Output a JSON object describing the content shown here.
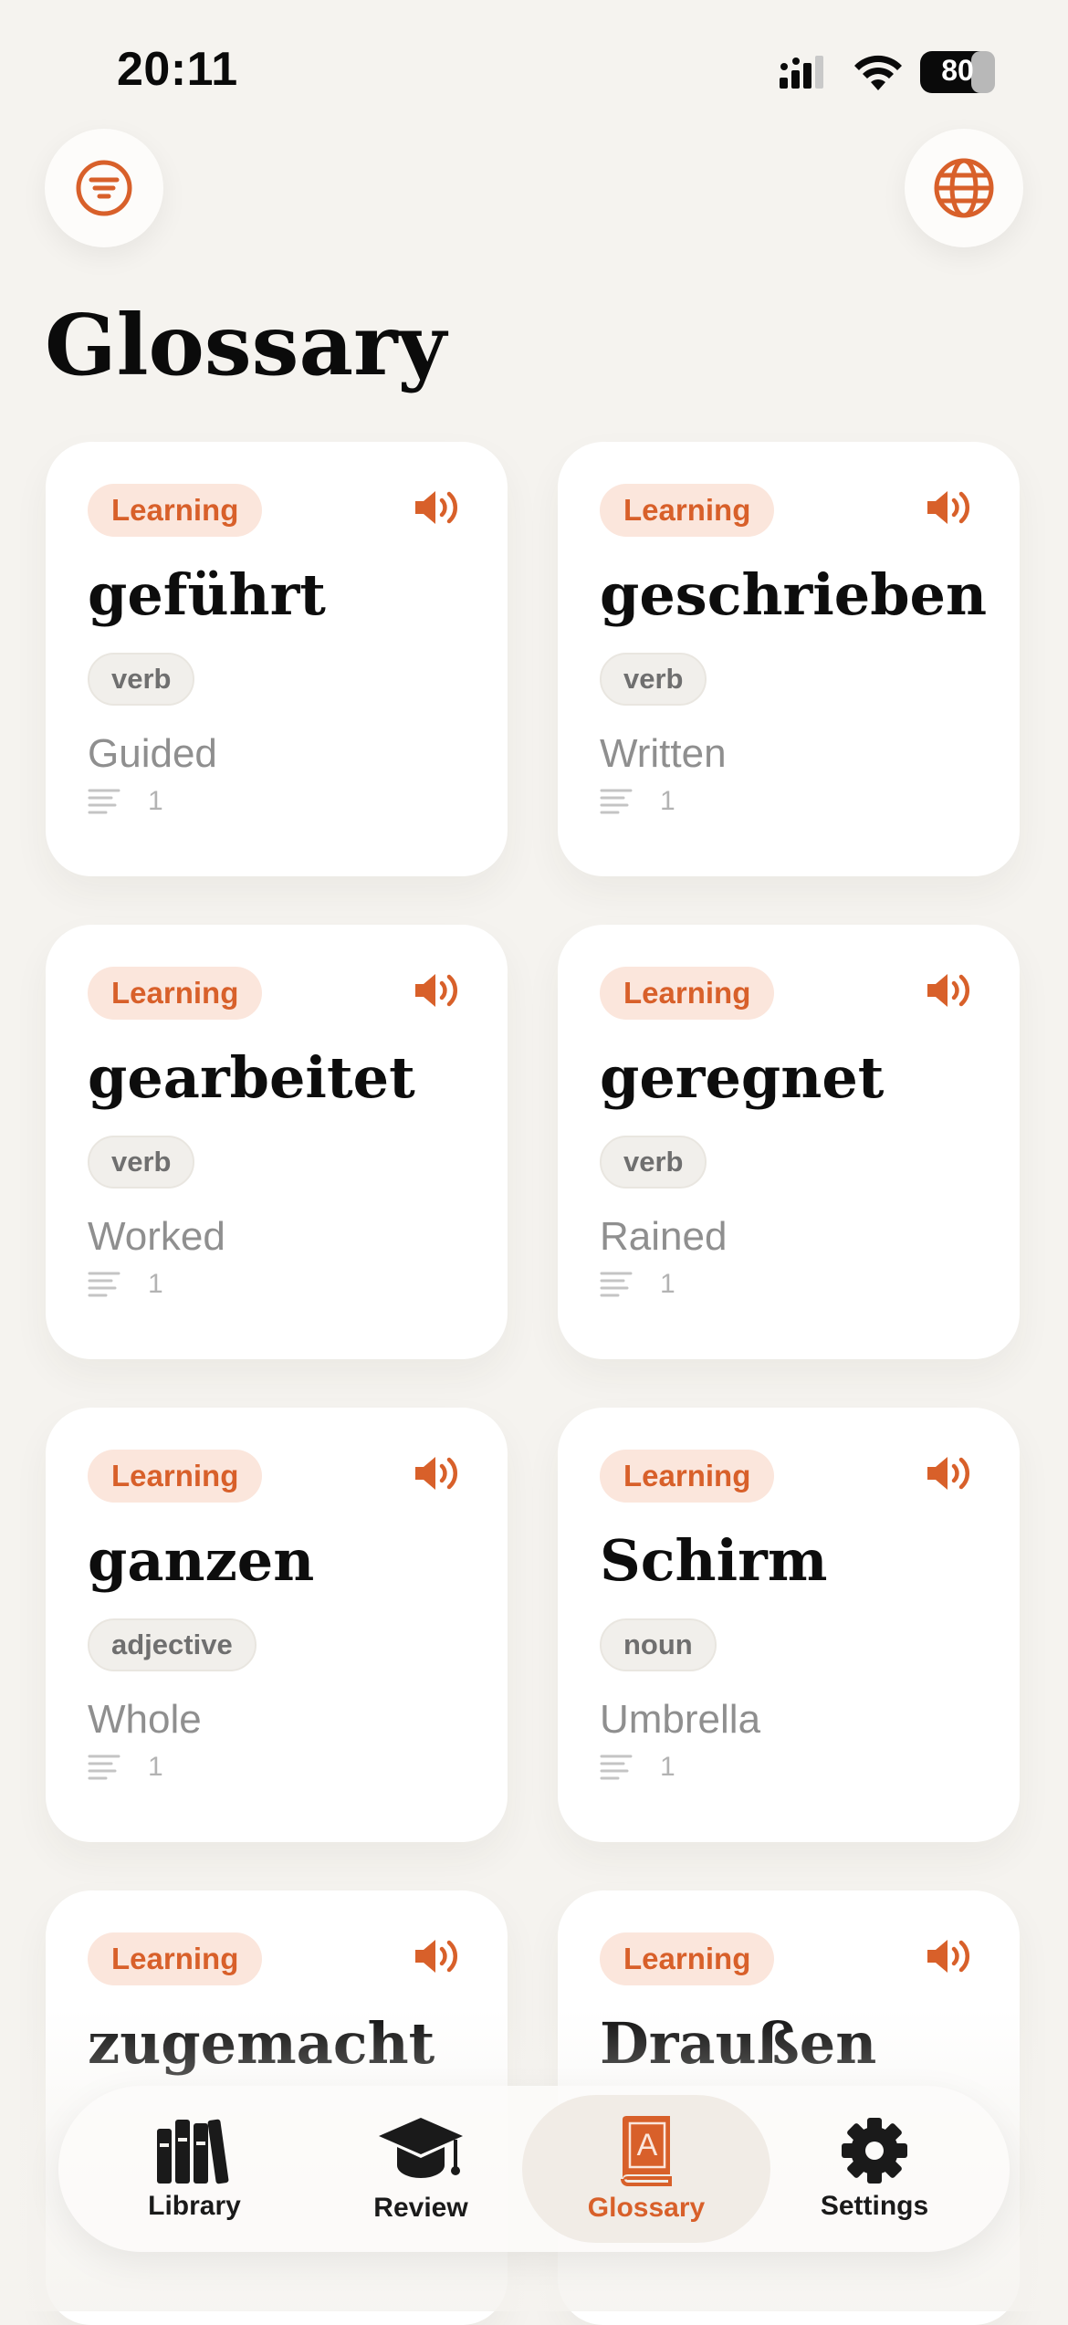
{
  "status_bar": {
    "time": "20:11",
    "battery": "80"
  },
  "header": {
    "title": "Glossary",
    "filter_icon": "filter-icon",
    "language_icon": "globe-icon"
  },
  "colors": {
    "accent": "#d8602a",
    "background": "#f5f3ef",
    "card": "#ffffff",
    "status_pill_bg": "#fbe6dc"
  },
  "cards": [
    {
      "status": "Learning",
      "word": "geführt",
      "pos": "verb",
      "meaning": "Guided",
      "refs": "1"
    },
    {
      "status": "Learning",
      "word": "geschrieben",
      "pos": "verb",
      "meaning": "Written",
      "refs": "1"
    },
    {
      "status": "Learning",
      "word": "gearbeitet",
      "pos": "verb",
      "meaning": "Worked",
      "refs": "1"
    },
    {
      "status": "Learning",
      "word": "geregnet",
      "pos": "verb",
      "meaning": "Rained",
      "refs": "1"
    },
    {
      "status": "Learning",
      "word": "ganzen",
      "pos": "adjective",
      "meaning": "Whole",
      "refs": "1"
    },
    {
      "status": "Learning",
      "word": "Schirm",
      "pos": "noun",
      "meaning": "Umbrella",
      "refs": "1"
    },
    {
      "status": "Learning",
      "word": "zugemacht",
      "pos": "",
      "meaning": "",
      "refs": ""
    },
    {
      "status": "Learning",
      "word": "Draußen",
      "pos": "",
      "meaning": "",
      "refs": ""
    }
  ],
  "tab_bar": {
    "tabs": [
      {
        "label": "Library",
        "icon": "books-icon",
        "active": false
      },
      {
        "label": "Review",
        "icon": "graduation-cap-icon",
        "active": false
      },
      {
        "label": "Glossary",
        "icon": "dictionary-icon",
        "active": true
      },
      {
        "label": "Settings",
        "icon": "gear-icon",
        "active": false
      }
    ]
  }
}
